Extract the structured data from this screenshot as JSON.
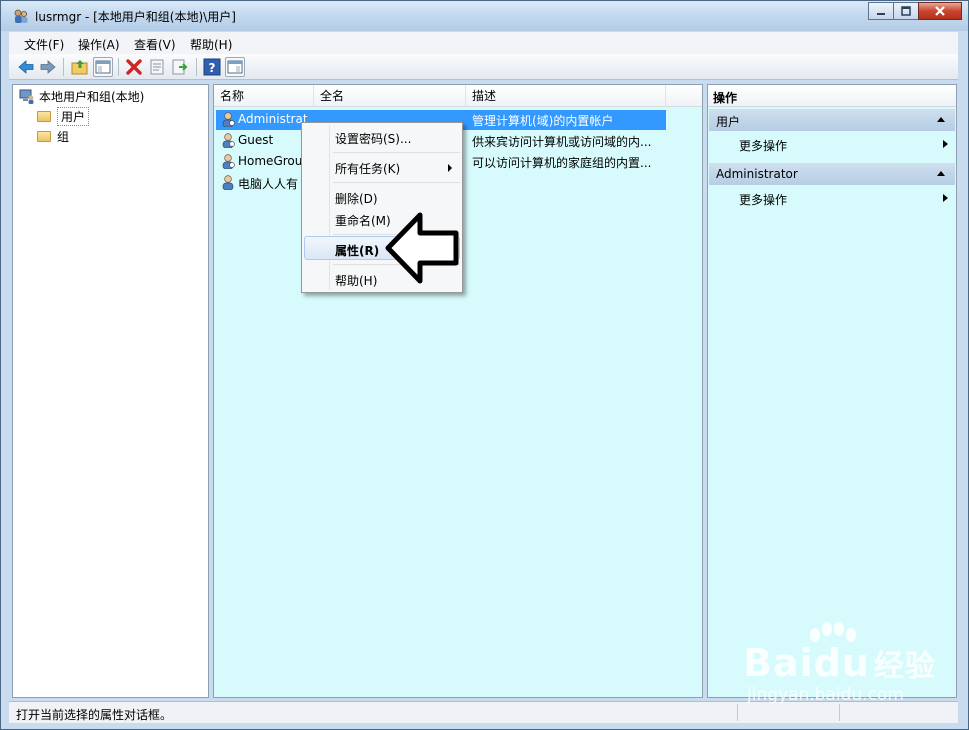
{
  "window": {
    "title": "lusrmgr - [本地用户和组(本地)\\用户]"
  },
  "menu": [
    "文件(F)",
    "操作(A)",
    "查看(V)",
    "帮助(H)"
  ],
  "toolbar": {
    "icons": [
      "back-icon",
      "forward-icon",
      "up-folder-icon",
      "show-tree-icon",
      "delete-icon",
      "properties-icon",
      "export-icon",
      "help-icon",
      "action-pane-icon"
    ]
  },
  "tree": {
    "root": "本地用户和组(本地)",
    "items": [
      "用户",
      "组"
    ]
  },
  "list": {
    "columns": [
      "名称",
      "全名",
      "描述"
    ],
    "rows": [
      {
        "name": "Administrat",
        "fullname": "",
        "desc": "管理计算机(域)的内置帐户"
      },
      {
        "name": "Guest",
        "fullname": "",
        "desc": "供来宾访问计算机或访问域的内..."
      },
      {
        "name": "HomeGrou",
        "fullname": "",
        "desc": "可以访问计算机的家庭组的内置..."
      },
      {
        "name": "电脑人人有",
        "fullname": "",
        "desc": ""
      }
    ]
  },
  "context_menu": {
    "items": [
      "设置密码(S)...",
      "所有任务(K)",
      "删除(D)",
      "重命名(M)",
      "属性(R)",
      "帮助(H)"
    ]
  },
  "actions": {
    "title": "操作",
    "sections": [
      {
        "header": "用户",
        "item": "更多操作"
      },
      {
        "header": "Administrator",
        "item": "更多操作"
      }
    ]
  },
  "status": {
    "text": "打开当前选择的属性对话框。"
  },
  "watermark": {
    "brand": "Bai",
    "brand2": "du",
    "cn": "经验",
    "url": "jingyan.baidu.com"
  }
}
